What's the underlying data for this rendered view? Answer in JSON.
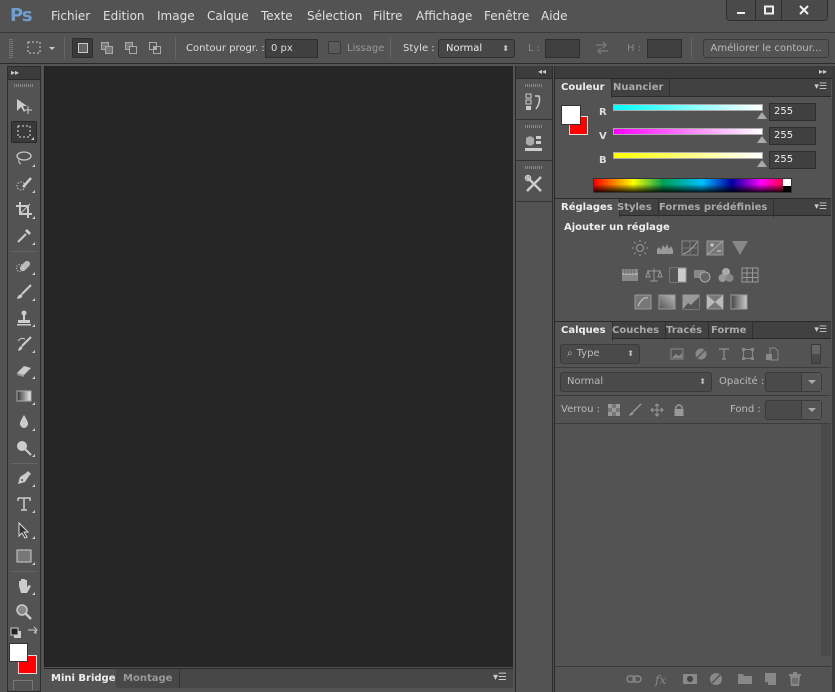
{
  "app": {
    "logo": "Ps"
  },
  "menu": [
    "Fichier",
    "Edition",
    "Image",
    "Calque",
    "Texte",
    "Sélection",
    "Filtre",
    "Affichage",
    "Fenêtre",
    "Aide"
  ],
  "window_controls": {
    "minimize": "—",
    "maximize": "☐",
    "close": "✕"
  },
  "options_bar": {
    "feather_label": "Contour progr. :",
    "feather_value": "0 px",
    "antialias_label": "Lissage",
    "style_label": "Style :",
    "style_value": "Normal",
    "width_label": "L :",
    "width_value": "",
    "height_label": "H :",
    "height_value": "",
    "refine_edge_label": "Améliorer le contour..."
  },
  "tools": [
    {
      "name": "move-tool"
    },
    {
      "name": "rectangular-marquee-tool",
      "active": true
    },
    {
      "name": "lasso-tool"
    },
    {
      "name": "quick-selection-tool"
    },
    {
      "name": "crop-tool"
    },
    {
      "name": "eyedropper-tool"
    },
    {
      "name": "spot-healing-tool"
    },
    {
      "name": "brush-tool"
    },
    {
      "name": "clone-stamp-tool"
    },
    {
      "name": "history-brush-tool"
    },
    {
      "name": "eraser-tool"
    },
    {
      "name": "gradient-tool"
    },
    {
      "name": "blur-tool"
    },
    {
      "name": "dodge-tool"
    },
    {
      "name": "pen-tool"
    },
    {
      "name": "type-tool"
    },
    {
      "name": "path-selection-tool"
    },
    {
      "name": "rectangle-tool"
    },
    {
      "name": "hand-tool"
    },
    {
      "name": "zoom-tool"
    }
  ],
  "colors": {
    "foreground": "#ffffff",
    "background": "#ff0000",
    "accent": "#6e9ecf"
  },
  "bottom_panel": {
    "tabs": [
      "Mini Bridge",
      "Montage"
    ],
    "active_tab": "Mini Bridge"
  },
  "dock": [
    "history-icon",
    "3d-icon",
    "tool-presets-icon"
  ],
  "color_panel": {
    "tabs": [
      "Couleur",
      "Nuancier"
    ],
    "active_tab": "Couleur",
    "channels": [
      {
        "label": "R",
        "value": "255"
      },
      {
        "label": "V",
        "value": "255"
      },
      {
        "label": "B",
        "value": "255"
      }
    ]
  },
  "adjustments_panel": {
    "tabs": [
      "Réglages",
      "Styles",
      "Formes prédéfinies"
    ],
    "active_tab": "Réglages",
    "title": "Ajouter un réglage"
  },
  "layers_panel": {
    "tabs": [
      "Calques",
      "Couches",
      "Tracés",
      "Forme"
    ],
    "active_tab": "Calques",
    "filter_value": "Type",
    "blend_mode": "Normal",
    "opacity_label": "Opacité :",
    "opacity_value": "",
    "lock_label": "Verrou :",
    "fill_label": "Fond :",
    "fill_value": ""
  }
}
